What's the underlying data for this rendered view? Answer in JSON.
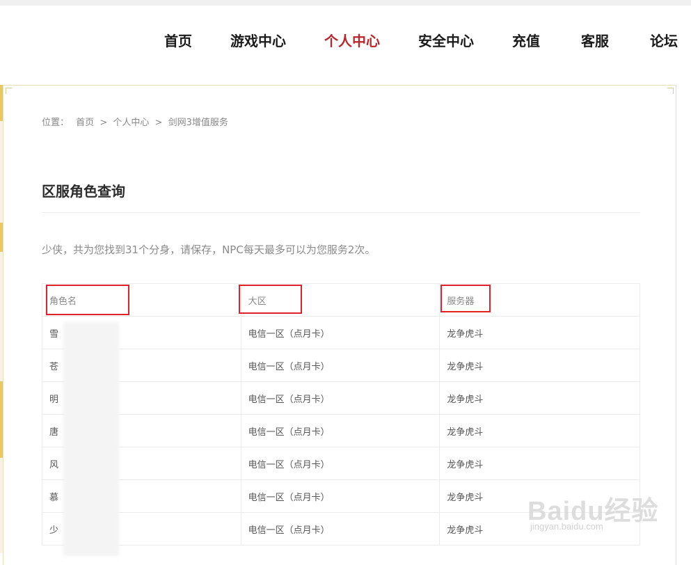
{
  "nav": {
    "items": [
      {
        "label": "首页",
        "active": false
      },
      {
        "label": "游戏中心",
        "active": false
      },
      {
        "label": "个人中心",
        "active": true
      },
      {
        "label": "安全中心",
        "active": false
      },
      {
        "label": "充值",
        "active": false
      },
      {
        "label": "客服",
        "active": false
      },
      {
        "label": "论坛",
        "active": false
      }
    ],
    "active_color": "#b8262b"
  },
  "breadcrumb": {
    "label": "位置：",
    "items": [
      "首页",
      "个人中心",
      "剑网3增值服务"
    ],
    "separator": ">"
  },
  "section": {
    "title": "区服角色查询",
    "result_message": "少侠，共为您找到31个分身，请保存，NPC每天最多可以为您服务2次。"
  },
  "table": {
    "headers": [
      "角色名",
      "大区",
      "服务器"
    ],
    "rows": [
      {
        "name": "雪",
        "region": "电信一区（点月卡）",
        "server": "龙争虎斗"
      },
      {
        "name": "苍",
        "region": "电信一区（点月卡）",
        "server": "龙争虎斗"
      },
      {
        "name": "明",
        "region": "电信一区（点月卡）",
        "server": "龙争虎斗"
      },
      {
        "name": "唐",
        "region": "电信一区（点月卡）",
        "server": "龙争虎斗"
      },
      {
        "name": "风",
        "region": "电信一区（点月卡）",
        "server": "龙争虎斗"
      },
      {
        "name": "慕",
        "region": "电信一区（点月卡）",
        "server": "龙争虎斗"
      },
      {
        "name": "少",
        "region": "电信一区（点月卡）",
        "server": "龙争虎斗"
      }
    ],
    "annotation_color": "#e0212b"
  },
  "watermark": {
    "brand": "Baidu经验",
    "sub": "jingyan.baidu.com"
  }
}
